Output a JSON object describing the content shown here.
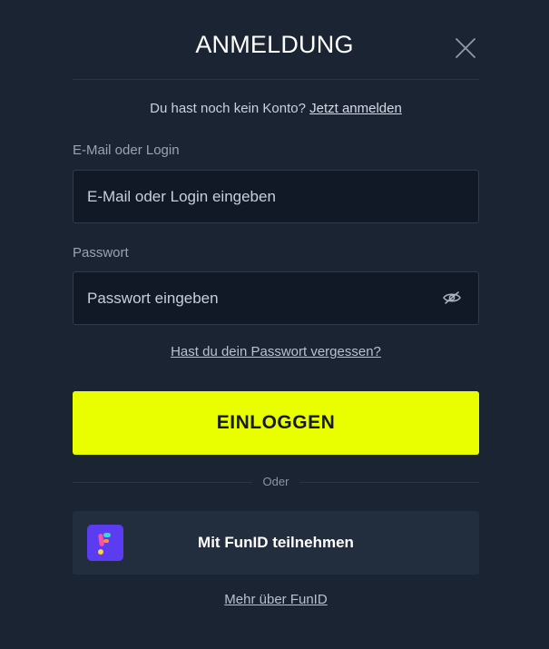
{
  "modal": {
    "title": "ANMELDUNG",
    "close_icon": "close-icon"
  },
  "signup": {
    "prompt": "Du hast noch kein Konto?",
    "link": "Jetzt anmelden"
  },
  "email_field": {
    "label": "E-Mail oder Login",
    "value": "",
    "placeholder": "E-Mail oder Login eingeben"
  },
  "password_field": {
    "label": "Passwort",
    "value": "",
    "placeholder": "Passwort eingeben",
    "toggle_icon": "eye-off-icon"
  },
  "forgot_password": "Hast du dein Passwort vergessen?",
  "login_button": "EINLOGGEN",
  "divider_text": "Oder",
  "funid": {
    "button_label": "Mit FunID teilnehmen",
    "logo_icon": "funid-logo-icon",
    "more_link": "Mehr über FunID"
  },
  "colors": {
    "background": "#1b2433",
    "accent": "#e9ff00",
    "input_background": "#111826",
    "funid_button": "#222d3d",
    "funid_logo": "#5b3cf0"
  }
}
